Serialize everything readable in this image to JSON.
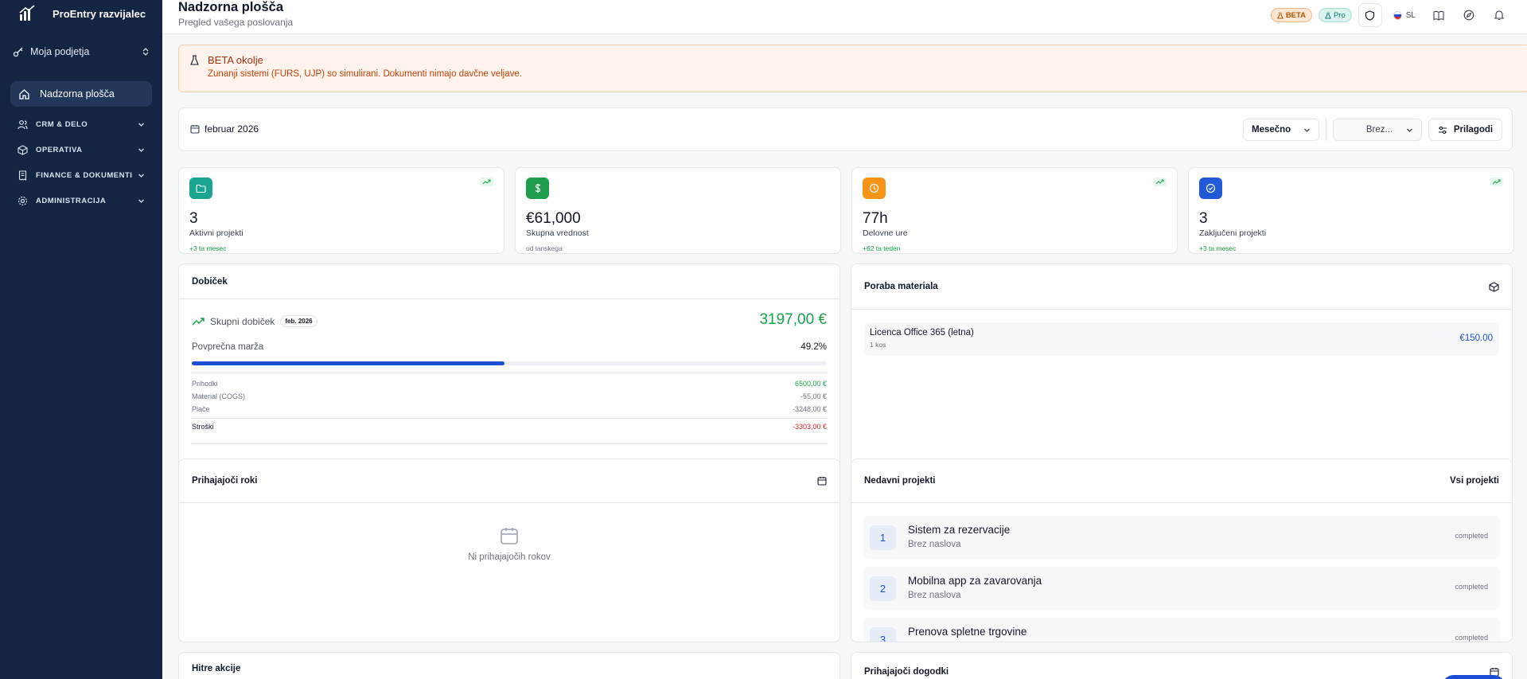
{
  "sidebar": {
    "app_name": "ProEntry razvijalec",
    "company_label": "Moja podjetja",
    "active_item": "Nadzorna plošča",
    "sections": [
      {
        "label": "CRM & DELO",
        "icon": "users-icon"
      },
      {
        "label": "OPERATIVA",
        "icon": "box-icon"
      },
      {
        "label": "FINANCE & DOKUMENTI",
        "icon": "receipt-icon"
      },
      {
        "label": "ADMINISTRACIJA",
        "icon": "gear-icon"
      }
    ]
  },
  "header": {
    "title": "Nadzorna plošča",
    "subtitle": "Pregled vašega poslovanja",
    "beta_badge": "BETA",
    "plan_badge": "Pro",
    "language": "SL"
  },
  "beta_notice": {
    "title": "BETA okolje",
    "text": "Zunanji sistemi (FURS, UJP) so simulirani. Dokumenti nimajo davčne veljave."
  },
  "toolbar": {
    "date": "februar 2026",
    "period_select": "Mesečno",
    "filter_select": "Brez...",
    "customize_label": "Prilagodi"
  },
  "stats": [
    {
      "value": "3",
      "label": "Aktivni projekti",
      "note": "+3 ta mesec",
      "icon": "folder-icon",
      "color": "#1aa591"
    },
    {
      "value": "€61,000",
      "label": "Skupna vrednost",
      "note": "od lanskega",
      "icon": "dollar-icon",
      "color": "#1f9d4d"
    },
    {
      "value": "77h",
      "label": "Delovne ure",
      "note": "+62 ta teden",
      "icon": "clock-icon",
      "color": "#f59416"
    },
    {
      "value": "3",
      "label": "Zaključeni projekti",
      "note": "+3 ta mesec",
      "icon": "check-circle-icon",
      "color": "#2159d8"
    }
  ],
  "profit": {
    "title": "Dobiček",
    "total_label": "Skupni dobiček",
    "period": "feb. 2026",
    "total": "3197,00 €",
    "margin_label": "Povprečna marža",
    "margin_value": "49.2%",
    "margin_fraction": 0.492,
    "rows": [
      {
        "label": "Prihodki",
        "value": "6500,00 €"
      },
      {
        "label": "Material (COGS)",
        "value": "-55,00 €"
      },
      {
        "label": "Plače",
        "value": "-3248,00 €"
      }
    ],
    "costs_label": "Stroški",
    "costs_value": "-3303,00 €"
  },
  "materials": {
    "title": "Poraba materiala",
    "items": [
      {
        "name": "Licenca Office 365 (letna)",
        "qty": "1 kos",
        "price": "€150.00"
      }
    ]
  },
  "deadlines": {
    "title": "Prihajajoči roki",
    "empty": "Ni prihajajočih rokov"
  },
  "recent_projects": {
    "title": "Nedavni projekti",
    "link": "Vsi projekti",
    "items": [
      {
        "num": "1",
        "title": "Sistem za rezervacije",
        "sub": "Brez naslova",
        "status": "completed"
      },
      {
        "num": "2",
        "title": "Mobilna app za zavarovanja",
        "sub": "Brez naslova",
        "status": "completed"
      },
      {
        "num": "3",
        "title": "Prenova spletne trgovine",
        "sub": "",
        "status": "completed"
      }
    ]
  },
  "quick_actions": {
    "title": "Hitre akcije"
  },
  "upcoming_events": {
    "title": "Prihajajoči dogodki"
  }
}
